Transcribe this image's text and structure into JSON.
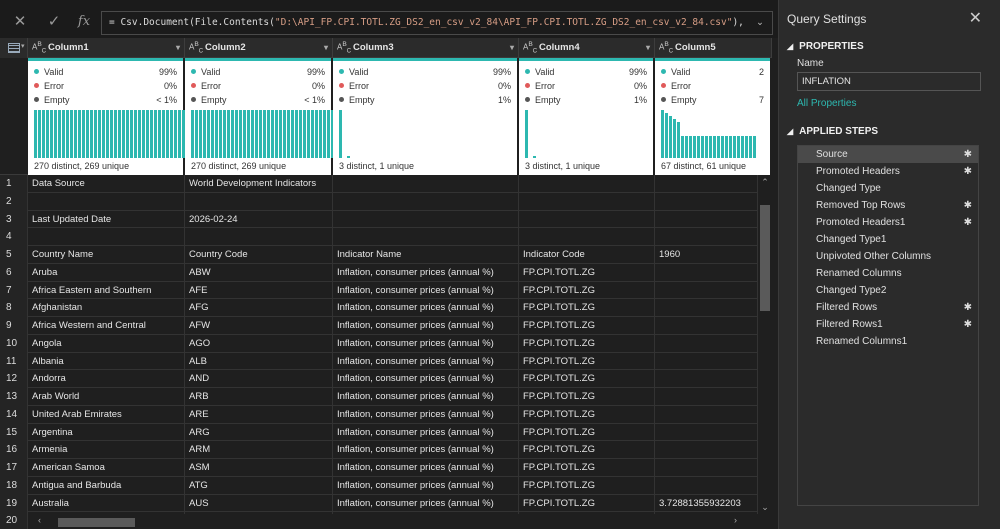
{
  "formula": {
    "prefix": "= Csv.Document(File.Contents(",
    "path": "\"D:\\API_FP.CPI.TOTL.ZG_DS2_en_csv_v2_84\\API_FP.CPI.TOTL.ZG_DS2_en_csv_v2_84.csv\"",
    "suffix": "),",
    "chevron": "⌄"
  },
  "columns": [
    {
      "name": "Column1",
      "type": "ABC",
      "valid": "99%",
      "error": "0%",
      "empty": "< 1%",
      "distinct": "270 distinct, 269 unique"
    },
    {
      "name": "Column2",
      "type": "ABC",
      "valid": "99%",
      "error": "0%",
      "empty": "< 1%",
      "distinct": "270 distinct, 269 unique"
    },
    {
      "name": "Column3",
      "type": "ABC",
      "valid": "99%",
      "error": "0%",
      "empty": "1%",
      "distinct": "3 distinct, 1 unique"
    },
    {
      "name": "Column4",
      "type": "ABC",
      "valid": "99%",
      "error": "0%",
      "empty": "1%",
      "distinct": "3 distinct, 1 unique"
    },
    {
      "name": "Column5",
      "type": "ABC",
      "valid": "2",
      "error": "",
      "empty": "7",
      "distinct": "67 distinct, 61 unique"
    }
  ],
  "profile_labels": {
    "valid": "Valid",
    "error": "Error",
    "empty": "Empty"
  },
  "colors": {
    "valid": "#2db8b0",
    "error": "#e05a5a",
    "empty": "#555555",
    "accent": "#2db8b0"
  },
  "rows": [
    {
      "n": "1",
      "c1": "Data Source",
      "c2": "World Development Indicators",
      "c3": "",
      "c4": "",
      "c5": ""
    },
    {
      "n": "2",
      "c1": "",
      "c2": "",
      "c3": "",
      "c4": "",
      "c5": ""
    },
    {
      "n": "3",
      "c1": "Last Updated Date",
      "c2": "2026-02-24",
      "c3": "",
      "c4": "",
      "c5": ""
    },
    {
      "n": "4",
      "c1": "",
      "c2": "",
      "c3": "",
      "c4": "",
      "c5": ""
    },
    {
      "n": "5",
      "c1": "Country Name",
      "c2": "Country Code",
      "c3": "Indicator Name",
      "c4": "Indicator Code",
      "c5": "1960"
    },
    {
      "n": "6",
      "c1": "Aruba",
      "c2": "ABW",
      "c3": "Inflation, consumer prices (annual %)",
      "c4": "FP.CPI.TOTL.ZG",
      "c5": ""
    },
    {
      "n": "7",
      "c1": "Africa Eastern and Southern",
      "c2": "AFE",
      "c3": "Inflation, consumer prices (annual %)",
      "c4": "FP.CPI.TOTL.ZG",
      "c5": ""
    },
    {
      "n": "8",
      "c1": "Afghanistan",
      "c2": "AFG",
      "c3": "Inflation, consumer prices (annual %)",
      "c4": "FP.CPI.TOTL.ZG",
      "c5": ""
    },
    {
      "n": "9",
      "c1": "Africa Western and Central",
      "c2": "AFW",
      "c3": "Inflation, consumer prices (annual %)",
      "c4": "FP.CPI.TOTL.ZG",
      "c5": ""
    },
    {
      "n": "10",
      "c1": "Angola",
      "c2": "AGO",
      "c3": "Inflation, consumer prices (annual %)",
      "c4": "FP.CPI.TOTL.ZG",
      "c5": ""
    },
    {
      "n": "11",
      "c1": "Albania",
      "c2": "ALB",
      "c3": "Inflation, consumer prices (annual %)",
      "c4": "FP.CPI.TOTL.ZG",
      "c5": ""
    },
    {
      "n": "12",
      "c1": "Andorra",
      "c2": "AND",
      "c3": "Inflation, consumer prices (annual %)",
      "c4": "FP.CPI.TOTL.ZG",
      "c5": ""
    },
    {
      "n": "13",
      "c1": "Arab World",
      "c2": "ARB",
      "c3": "Inflation, consumer prices (annual %)",
      "c4": "FP.CPI.TOTL.ZG",
      "c5": ""
    },
    {
      "n": "14",
      "c1": "United Arab Emirates",
      "c2": "ARE",
      "c3": "Inflation, consumer prices (annual %)",
      "c4": "FP.CPI.TOTL.ZG",
      "c5": ""
    },
    {
      "n": "15",
      "c1": "Argentina",
      "c2": "ARG",
      "c3": "Inflation, consumer prices (annual %)",
      "c4": "FP.CPI.TOTL.ZG",
      "c5": ""
    },
    {
      "n": "16",
      "c1": "Armenia",
      "c2": "ARM",
      "c3": "Inflation, consumer prices (annual %)",
      "c4": "FP.CPI.TOTL.ZG",
      "c5": ""
    },
    {
      "n": "17",
      "c1": "American Samoa",
      "c2": "ASM",
      "c3": "Inflation, consumer prices (annual %)",
      "c4": "FP.CPI.TOTL.ZG",
      "c5": ""
    },
    {
      "n": "18",
      "c1": "Antigua and Barbuda",
      "c2": "ATG",
      "c3": "Inflation, consumer prices (annual %)",
      "c4": "FP.CPI.TOTL.ZG",
      "c5": ""
    },
    {
      "n": "19",
      "c1": "Australia",
      "c2": "AUS",
      "c3": "Inflation, consumer prices (annual %)",
      "c4": "FP.CPI.TOTL.ZG",
      "c5": "3.72881355932203"
    },
    {
      "n": "20",
      "c1": "",
      "c2": "",
      "c3": "",
      "c4": "",
      "c5": ""
    }
  ],
  "settings": {
    "title": "Query Settings",
    "properties_title": "PROPERTIES",
    "name_label": "Name",
    "name_value": "INFLATION",
    "all_properties": "All Properties",
    "applied_steps_title": "APPLIED STEPS",
    "steps": [
      {
        "label": "Source",
        "gear": true,
        "selected": true
      },
      {
        "label": "Promoted Headers",
        "gear": true,
        "selected": false
      },
      {
        "label": "Changed Type",
        "gear": false,
        "selected": false
      },
      {
        "label": "Removed Top Rows",
        "gear": true,
        "selected": false
      },
      {
        "label": "Promoted Headers1",
        "gear": true,
        "selected": false
      },
      {
        "label": "Changed Type1",
        "gear": false,
        "selected": false
      },
      {
        "label": "Unpivoted Other Columns",
        "gear": false,
        "selected": false
      },
      {
        "label": "Renamed Columns",
        "gear": false,
        "selected": false
      },
      {
        "label": "Changed Type2",
        "gear": false,
        "selected": false
      },
      {
        "label": "Filtered Rows",
        "gear": true,
        "selected": false
      },
      {
        "label": "Filtered Rows1",
        "gear": true,
        "selected": false
      },
      {
        "label": "Renamed Columns1",
        "gear": false,
        "selected": false
      }
    ]
  },
  "icons": {
    "cancel": "close-icon",
    "commit": "check-icon",
    "fx": "fx-icon",
    "gear": "gear-icon",
    "close": "close-icon"
  }
}
